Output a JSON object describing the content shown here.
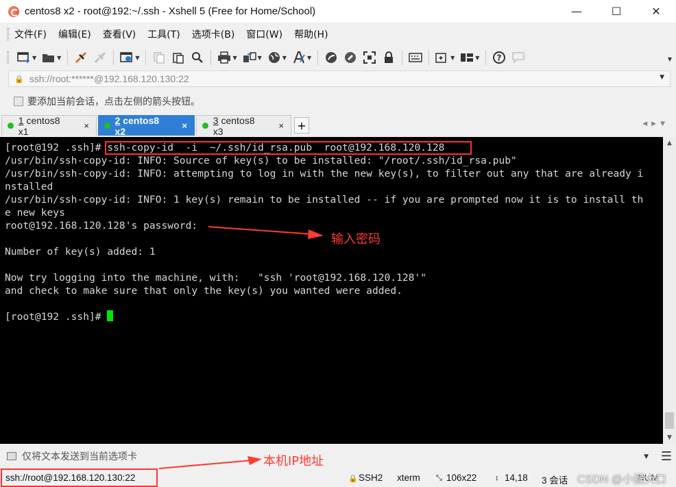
{
  "window": {
    "title": "centos8 x2 - root@192:~/.ssh - Xshell 5 (Free for Home/School)",
    "minimize": "—",
    "maximize": "☐",
    "close": "✕"
  },
  "menu": [
    "文件(F)",
    "编辑(E)",
    "查看(V)",
    "工具(T)",
    "选项卡(B)",
    "窗口(W)",
    "帮助(H)"
  ],
  "address": {
    "value": "ssh://root:******@192.168.120.130:22"
  },
  "hint": "要添加当前会话，点击左侧的箭头按钮。",
  "tabs": [
    {
      "num": "1",
      "name": " centos8 x1",
      "active": false
    },
    {
      "num": "2",
      "name": " centos8 x2",
      "active": true
    },
    {
      "num": "3",
      "name": " centos8 x3",
      "active": false
    }
  ],
  "tab_close": "×",
  "tab_add": "+",
  "terminal": {
    "prompt": "[root@192 .ssh]#",
    "command": " ssh-copy-id  -i  ~/.ssh/id_rsa.pub  root@192.168.120.128",
    "lines": [
      "/usr/bin/ssh-copy-id: INFO: Source of key(s) to be installed: \"/root/.ssh/id_rsa.pub\"",
      "/usr/bin/ssh-copy-id: INFO: attempting to log in with the new key(s), to filter out any that are already i",
      "nstalled",
      "/usr/bin/ssh-copy-id: INFO: 1 key(s) remain to be installed -- if you are prompted now it is to install th",
      "e new keys",
      "root@192.168.120.128's password:",
      "",
      "Number of key(s) added: 1",
      "",
      "Now try logging into the machine, with:   \"ssh 'root@192.168.120.128'\"",
      "and check to make sure that only the key(s) you wanted were added.",
      ""
    ],
    "final_prompt": "[root@192 .ssh]# "
  },
  "annotations": {
    "password_note": "输入密码",
    "ip_note": "本机IP地址"
  },
  "compose": "仅将文本发送到当前选项卡",
  "status": {
    "connection": "ssh://root@192.168.120.130:22",
    "protocol": "SSH2",
    "terminal_type": "xterm",
    "size": "106x22",
    "cursor": "14,18",
    "sessions": "3 会话",
    "mode": "NUM"
  },
  "watermark": "CSDN @小猴大口",
  "colors": {
    "active_tab": "#2f7fd6",
    "annotation": "#ff3b30",
    "cursor": "#00e600"
  }
}
